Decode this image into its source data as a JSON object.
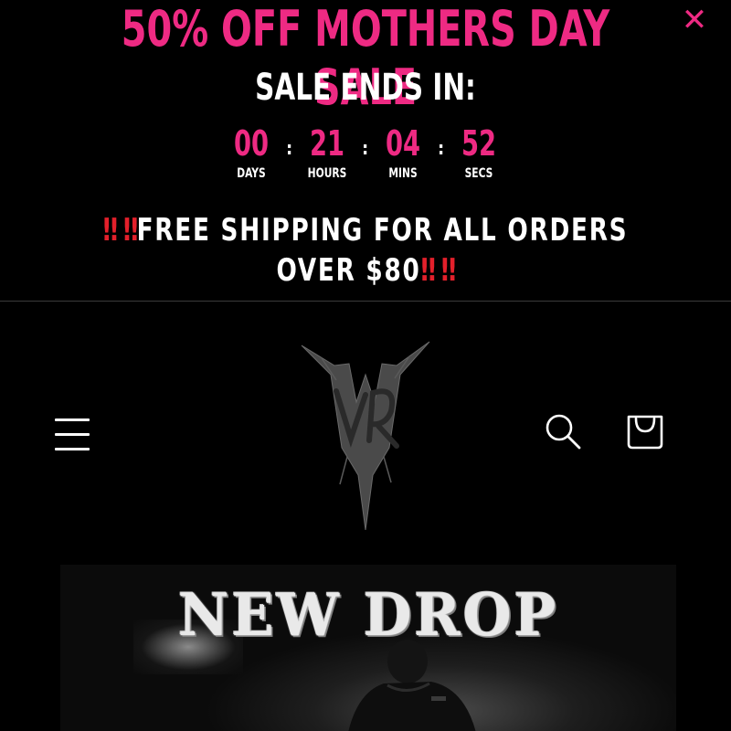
{
  "announcement": {
    "sale_title": "50% OFF MOTHERS DAY SALE",
    "close_glyph": "✕",
    "ends_in": "SALE ENDS IN:",
    "countdown": {
      "days": {
        "value": "00",
        "label": "DAYS"
      },
      "hours": {
        "value": "21",
        "label": "HOURS"
      },
      "mins": {
        "value": "04",
        "label": "MINS"
      },
      "secs": {
        "value": "52",
        "label": "SECS"
      },
      "separator": ":"
    },
    "shipping": {
      "prefix_emoji": "‼ ‼",
      "text": "FREE SHIPPING FOR ALL ORDERS OVER $80",
      "suffix_emoji": "‼ ‼"
    }
  },
  "header": {
    "icons": [
      "menu-icon",
      "search-icon",
      "cart-icon"
    ]
  },
  "hero": {
    "title": "NEW DROP"
  },
  "colors": {
    "accent": "#ee2a83",
    "alert": "#e3202b",
    "background": "#000000",
    "text": "#ffffff"
  }
}
